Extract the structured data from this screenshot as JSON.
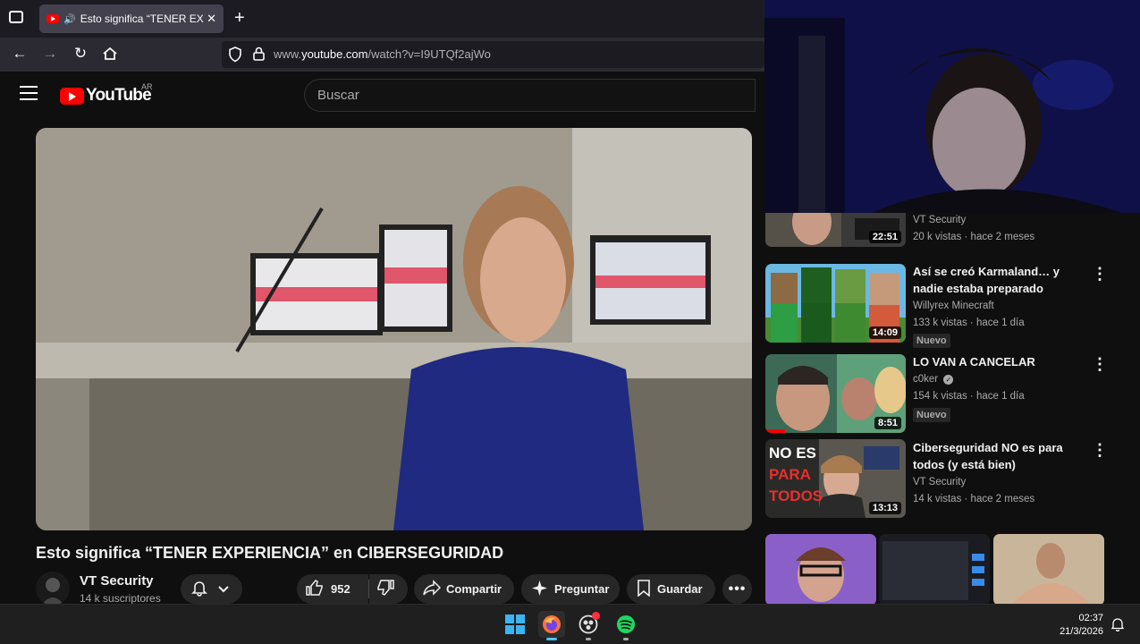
{
  "browser": {
    "tab_title": "Esto significa “TENER EXPERI",
    "url_prefix": "www.",
    "url_domain": "youtube.com",
    "url_path": "/watch?v=I9UTQf2ajWo"
  },
  "youtube": {
    "logo_text": "YouTube",
    "country": "AR",
    "search_placeholder": "Buscar"
  },
  "video": {
    "title": "Esto significa “TENER EXPERIENCIA” en CIBERSEGURIDAD",
    "channel_name": "VT Security",
    "channel_subs": "14 k suscriptores",
    "likes": "952",
    "share_label": "Compartir",
    "ask_label": "Preguntar",
    "save_label": "Guardar"
  },
  "sidebar": {
    "items": [
      {
        "title": "",
        "channel": "VT Security",
        "meta": "20 k vistas · hace 2 meses",
        "duration": "22:51",
        "badge": ""
      },
      {
        "title": "Así se creó Karmaland… y nadie estaba preparado",
        "channel": "Willyrex Minecraft",
        "meta": "133 k vistas · hace 1 día",
        "duration": "14:09",
        "badge": "Nuevo"
      },
      {
        "title": "LO VAN A CANCELAR",
        "channel": "c0ker",
        "meta": "154 k vistas · hace 1 día",
        "duration": "8:51",
        "badge": "Nuevo"
      },
      {
        "title": "Ciberseguridad NO es para todos (y está bien)",
        "channel": "VT Security",
        "meta": "14 k vistas · hace 2 meses",
        "duration": "13:13",
        "badge": ""
      }
    ],
    "thumb4_text": [
      "NO ES",
      "PARA",
      "TODOS"
    ]
  },
  "taskbar": {
    "time": "02:37",
    "date": "21/3/2026"
  },
  "colors": {
    "yt_red": "#ff0000",
    "background": "#0f0f0f",
    "chip": "#272727"
  }
}
